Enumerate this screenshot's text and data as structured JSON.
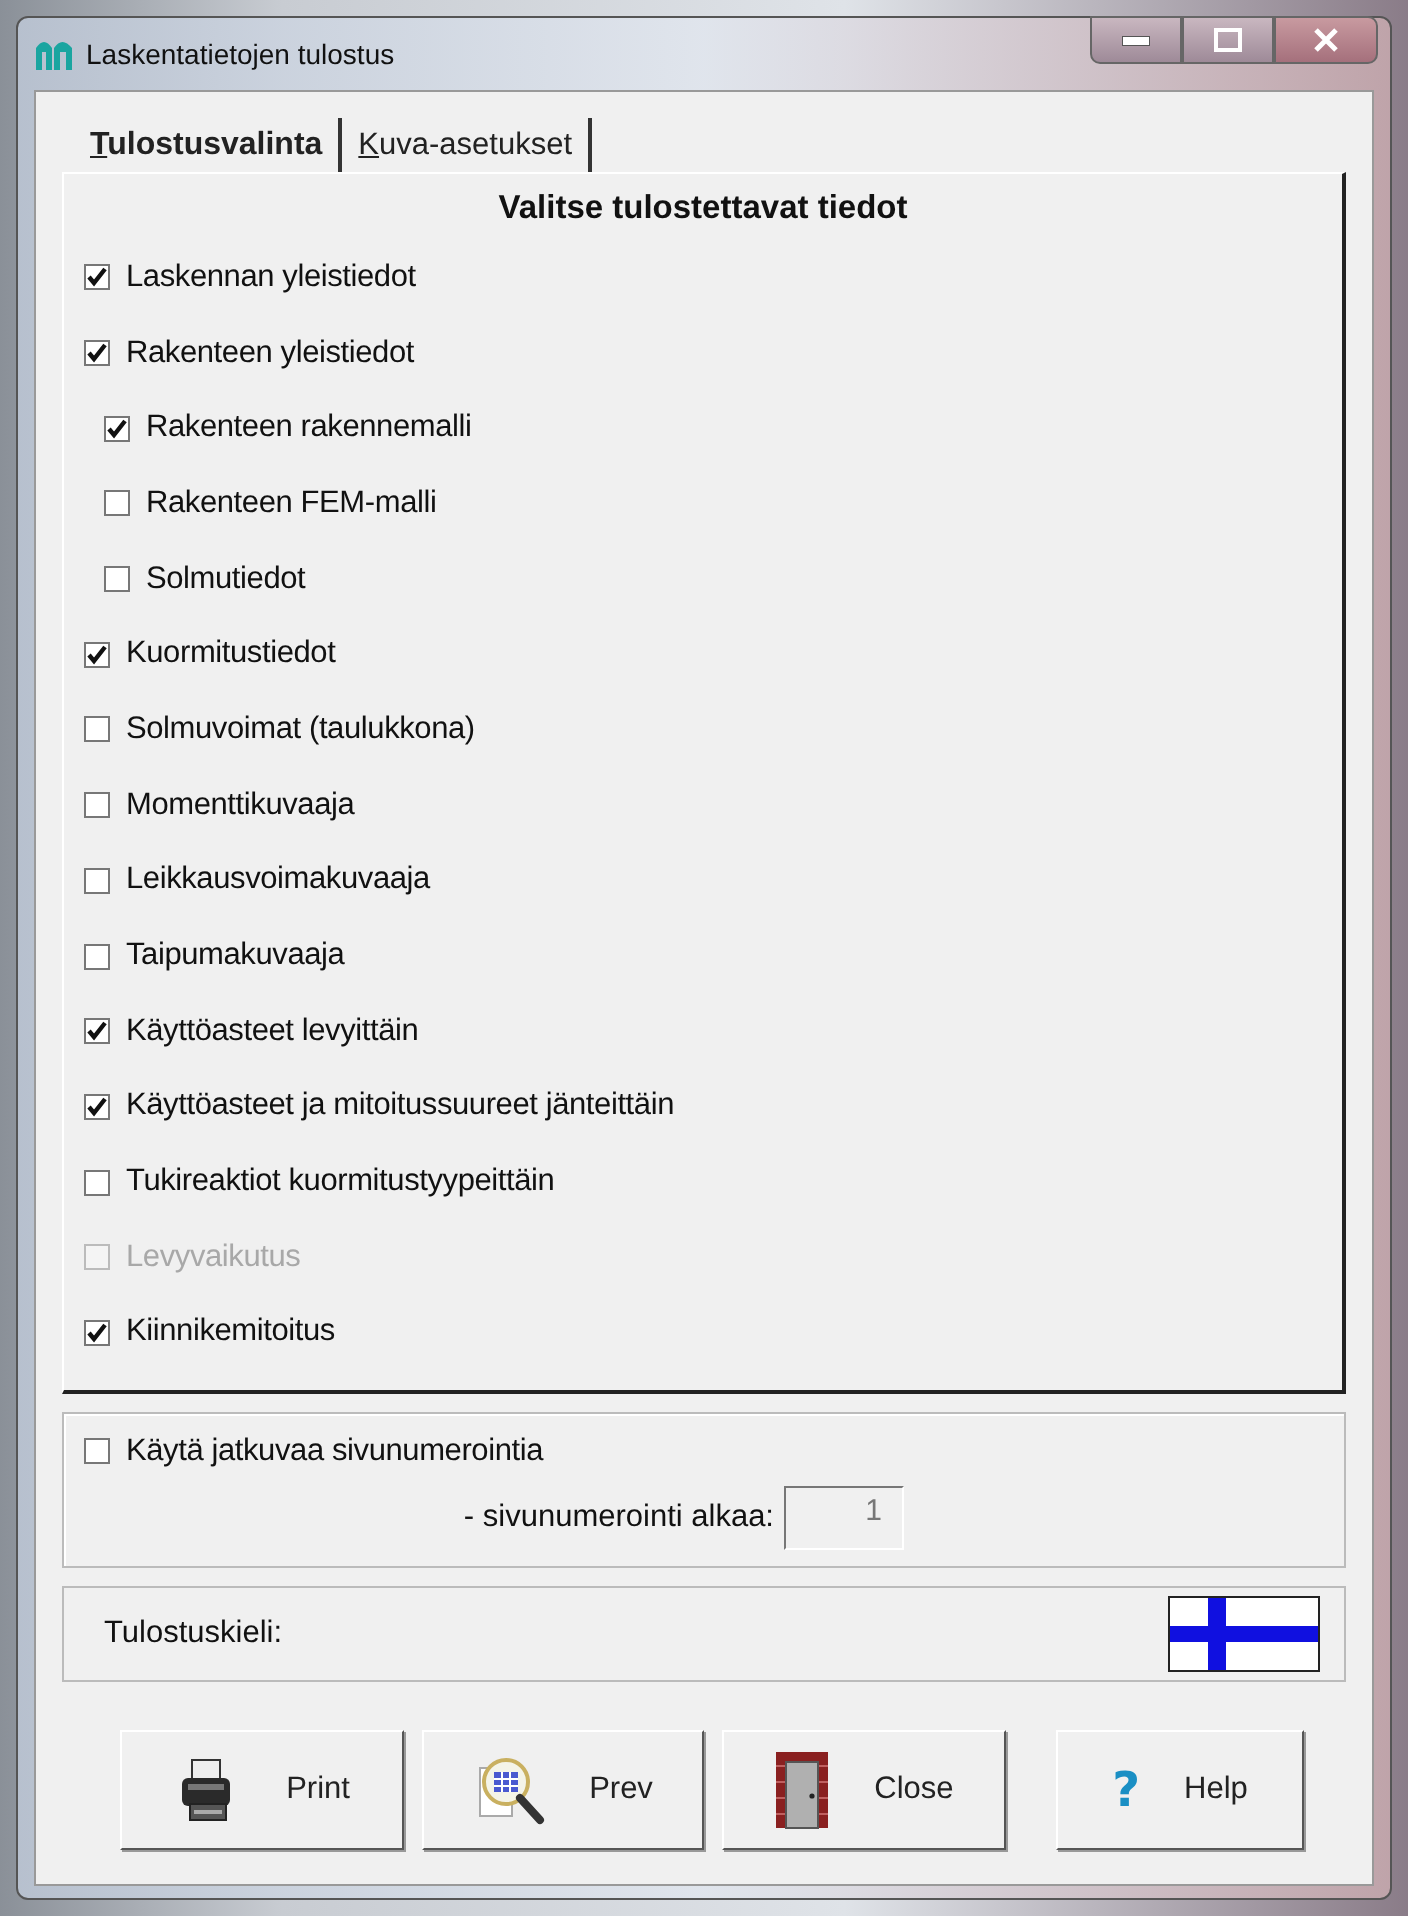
{
  "window": {
    "title": "Laskentatietojen tulostus"
  },
  "tabs": [
    {
      "label": "Tulostusvalinta",
      "selected": true
    },
    {
      "label": "Kuva-asetukset",
      "selected": false
    }
  ],
  "heading": "Valitse tulostettavat tiedot",
  "items": [
    {
      "label": "Laskennan yleistiedot",
      "checked": true,
      "disabled": false
    },
    {
      "label": "Rakenteen yleistiedot",
      "checked": true,
      "disabled": false,
      "children": [
        {
          "label": "Rakenteen rakennemalli",
          "checked": true,
          "disabled": false
        },
        {
          "label": "Rakenteen FEM-malli",
          "checked": false,
          "disabled": false
        },
        {
          "label": "Solmutiedot",
          "checked": false,
          "disabled": false
        }
      ]
    },
    {
      "label": "Kuormitustiedot",
      "checked": true,
      "disabled": false
    },
    {
      "label": "Solmuvoimat (taulukkona)",
      "checked": false,
      "disabled": false
    },
    {
      "label": "Momenttikuvaaja",
      "checked": false,
      "disabled": false
    },
    {
      "label": "Leikkausvoimakuvaaja",
      "checked": false,
      "disabled": false
    },
    {
      "label": "Taipumakuvaaja",
      "checked": false,
      "disabled": false
    },
    {
      "label": "Käyttöasteet levyittäin",
      "checked": true,
      "disabled": false
    },
    {
      "label": "Käyttöasteet ja mitoitussuureet jänteittäin",
      "checked": true,
      "disabled": false
    },
    {
      "label": "Tukireaktiot kuormitustyypeittäin",
      "checked": false,
      "disabled": false
    },
    {
      "label": "Levyvaikutus",
      "checked": false,
      "disabled": true
    },
    {
      "label": "Kiinnikemitoitus",
      "checked": true,
      "disabled": false
    }
  ],
  "paging": {
    "checkbox": {
      "label": "Käytä jatkuvaa sivunumerointia",
      "checked": false,
      "disabled": false
    },
    "start_label": "- sivunumerointi alkaa:",
    "start_value": "1"
  },
  "language": {
    "label": "Tulostuskieli:"
  },
  "buttons": [
    {
      "kind": "print",
      "label": "Print"
    },
    {
      "kind": "preview",
      "label": "Prev"
    },
    {
      "kind": "close",
      "label": "Close"
    },
    {
      "kind": "help",
      "label": "Help",
      "glyph": "?"
    }
  ]
}
